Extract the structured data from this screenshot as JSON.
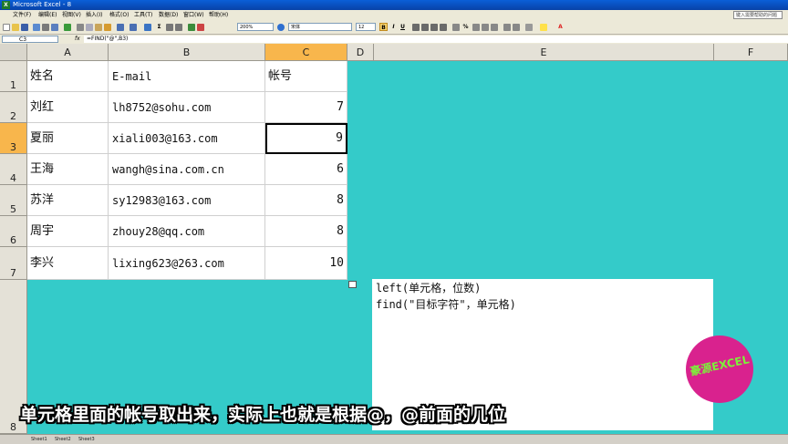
{
  "window": {
    "title": "Microsoft Excel - 8"
  },
  "menu": {
    "items": [
      "文件(F)",
      "编辑(E)",
      "视图(V)",
      "插入(I)",
      "格式(O)",
      "工具(T)",
      "数据(D)",
      "窗口(W)",
      "帮助(H)"
    ],
    "help_placeholder": "键入需要帮助的问题"
  },
  "toolbar": {
    "zoom": "200%",
    "font_name": "宋体",
    "font_size": "12",
    "bold": "B",
    "italic": "I",
    "underline": "U"
  },
  "formula_bar": {
    "name_box": "C3",
    "fx": "fx",
    "formula": "=FIND(\"@\",B3)"
  },
  "columns": [
    "A",
    "B",
    "C",
    "D",
    "E",
    "F"
  ],
  "rows": [
    "1",
    "2",
    "3",
    "4",
    "5",
    "6",
    "7",
    "8"
  ],
  "selected_cell": "C3",
  "table": [
    {
      "name": "姓名",
      "email": "E-mail",
      "account": "帐号"
    },
    {
      "name": "刘红",
      "email": "lh8752@sohu.com",
      "account": "7"
    },
    {
      "name": "夏丽",
      "email": "xiali003@163.com",
      "account": "9"
    },
    {
      "name": "王海",
      "email": "wangh@sina.com.cn",
      "account": "6"
    },
    {
      "name": "苏洋",
      "email": "sy12983@163.com",
      "account": "8"
    },
    {
      "name": "周宇",
      "email": "zhouy28@qq.com",
      "account": "8"
    },
    {
      "name": "李兴",
      "email": "lixing623@263.com",
      "account": "10"
    }
  ],
  "note_box": {
    "line1": "left(单元格，位数)",
    "line2": "find(\"目标字符\"，单元格)"
  },
  "subtitle": "单元格里面的帐号取出来，实际上也就是根据@，@前面的几位",
  "logo": "豪源EXCEL",
  "sheets": [
    "Sheet1",
    "Sheet2",
    "Sheet3"
  ],
  "colors": {
    "sheet_bg": "#34cbc9",
    "selected_header": "#f8b64c",
    "logo_bg": "#d9228e",
    "logo_text": "#7cf13a"
  }
}
